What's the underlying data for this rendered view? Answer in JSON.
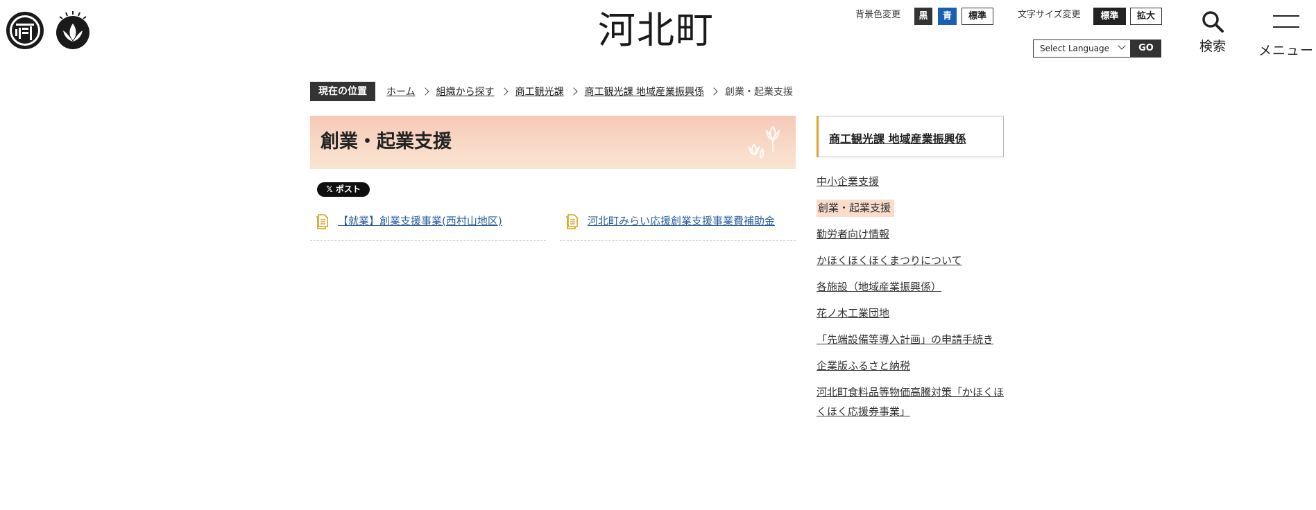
{
  "header": {
    "site_title": "河北町",
    "background_color": {
      "label": "背景色変更",
      "options": [
        "黒",
        "青",
        "標準"
      ]
    },
    "font_size": {
      "label": "文字サイズ変更",
      "options": [
        "標準",
        "拡大"
      ]
    },
    "language": {
      "selected": "Select Language",
      "go_label": "GO"
    },
    "search_label": "検索",
    "menu_label": "メニュー"
  },
  "breadcrumb": {
    "label": "現在の位置",
    "items": [
      "ホーム",
      "組織から探す",
      "商工観光課",
      "商工観光課 地域産業振興係"
    ],
    "current": "創業・起業支援"
  },
  "main": {
    "title": "創業・起業支援",
    "share_label": "ポスト",
    "links": [
      "【就業】創業支援事業(西村山地区)",
      "河北町みらい応援創業支援事業費補助金"
    ]
  },
  "sidebar": {
    "heading": "商工観光課 地域産業振興係",
    "items": [
      "中小企業支援",
      "創業・起業支援",
      "勤労者向け情報",
      "かほくほくほくまつりについて",
      "各施設（地域産業振興係）",
      "花ノ木工業団地",
      "「先端設備等導入計画」の申請手続き",
      "企業版ふるさと納税",
      "河北町食料品等物価高騰対策「かほくほくほく応援券事業」"
    ],
    "active_index": 1
  },
  "colors": {
    "accent": "#e0a030",
    "link": "#2a5d9e",
    "heading_gradient_top": "#f8c8b8",
    "heading_gradient_bottom": "#f9e6d2",
    "bg_blue": "#1a5fb4"
  }
}
